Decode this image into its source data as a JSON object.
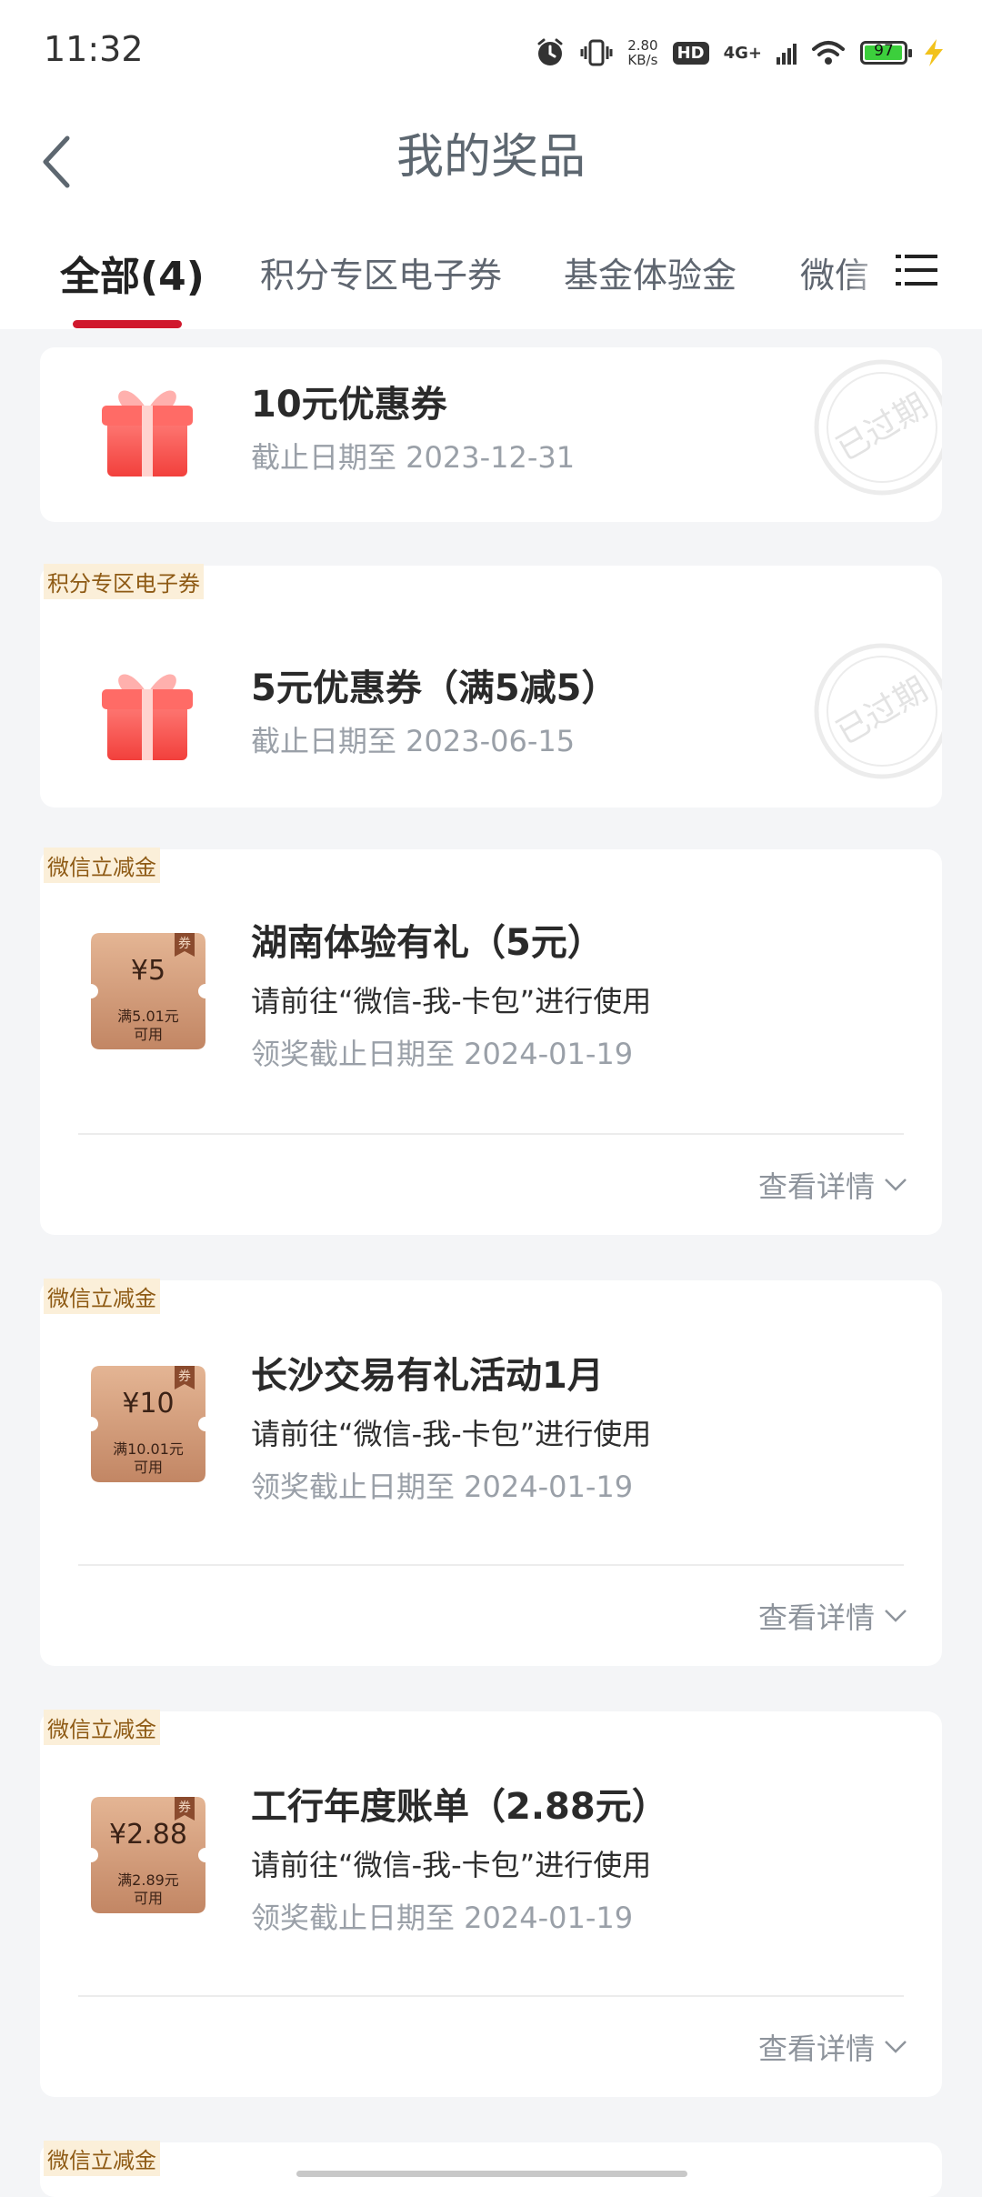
{
  "status_bar": {
    "time": "11:32",
    "speed_value": "2.80",
    "speed_unit": "KB/s",
    "hd": "HD",
    "network": "4G+",
    "battery": "97"
  },
  "header": {
    "title": "我的奖品"
  },
  "tabs": [
    {
      "label": "全部(4)"
    },
    {
      "label": "积分专区电子券"
    },
    {
      "label": "基金体验金"
    },
    {
      "label": "微信"
    }
  ],
  "expired_stamp": "已过期",
  "details_label": "查看详情",
  "prizes": [
    {
      "tag": "",
      "title": "10元优惠券",
      "date": "截止日期至 2023-12-31",
      "status": "已过期"
    },
    {
      "tag": "积分专区电子券",
      "title": "5元优惠券（满5减5）",
      "date": "截止日期至 2023-06-15",
      "status": "已过期"
    },
    {
      "tag": "微信立减金",
      "coupon_amount": "¥5",
      "coupon_cond_1": "满5.01元",
      "coupon_cond_2": "可用",
      "coupon_badge": "券",
      "title": "湖南体验有礼（5元）",
      "sub": "请前往“微信-我-卡包”进行使用",
      "date": "领奖截止日期至 2024-01-19"
    },
    {
      "tag": "微信立减金",
      "coupon_amount": "¥10",
      "coupon_cond_1": "满10.01元",
      "coupon_cond_2": "可用",
      "coupon_badge": "券",
      "title": "长沙交易有礼活动1月",
      "sub": "请前往“微信-我-卡包”进行使用",
      "date": "领奖截止日期至 2024-01-19"
    },
    {
      "tag": "微信立减金",
      "coupon_amount": "¥2.88",
      "coupon_cond_1": "满2.89元",
      "coupon_cond_2": "可用",
      "coupon_badge": "券",
      "title": "工行年度账单（2.88元）",
      "sub": "请前往“微信-我-卡包”进行使用",
      "date": "领奖截止日期至 2024-01-19"
    },
    {
      "tag": "微信立减金"
    }
  ],
  "colors": {
    "accent": "#d0182d",
    "tag_bg": "#fbefd9",
    "tag_text": "#8e5a14",
    "coupon": "#c9926f"
  }
}
